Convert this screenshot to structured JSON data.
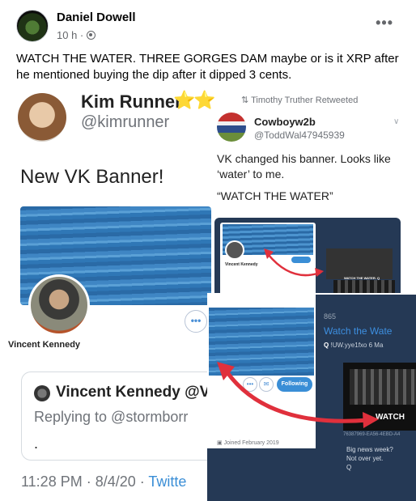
{
  "post": {
    "author": "Daniel Dowell",
    "time": "10 h ·",
    "more_label": "•••",
    "text": "WATCH THE WATER. THREE GORGES DAM maybe or is it XRP after he mentioned buying the dip after it dipped 3 cents."
  },
  "kim_tweet": {
    "name": "Kim Runner",
    "stars": "⭐⭐",
    "handle": "@kimrunner",
    "body": "New VK Banner!",
    "profile_name": "Vincent Kennedy",
    "edit_dots": "•••",
    "quote_name": "Vincent Kennedy @V",
    "quote_reply": "Replying to @stormborr",
    "quote_dot": ".",
    "time": "11:28 PM · 8/4/20 · ",
    "source": "Twitte"
  },
  "cowboy_tweet": {
    "retweet_label": "Timothy Truther Retweeted",
    "name": "Cowboyw2b",
    "handle": "@ToddWal47945939",
    "chevron": "∨",
    "text": "VK changed his banner. Looks like ‘water’ to me.",
    "quote": "“WATCH THE WATER”"
  },
  "mini_screenshot": {
    "name": "Vincent Kennedy",
    "caption": "WATCH THE WATER. Q"
  },
  "zoom_screenshot": {
    "follow_label": "Following",
    "joined": "Joined February 2019",
    "post_number": "865",
    "title": "Watch the Wate",
    "id_prefix": "Q",
    "id_value": "!UW.yye1fxo",
    "id_date": "6 Ma",
    "caption": "WATCH",
    "hash": "76387969-EA56-4EBD-A4",
    "news_line1": "Big news week?",
    "news_line2": "Not over yet.",
    "news_line3": "Q"
  },
  "colors": {
    "arrow": "#e0303c",
    "link": "#3a8ed6",
    "dark_panel": "#253955"
  }
}
